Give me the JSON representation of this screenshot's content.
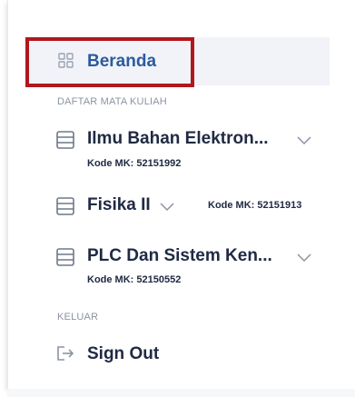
{
  "nav": {
    "home_label": "Beranda",
    "home_icon": "grid-icon"
  },
  "courses_section": {
    "heading": "DAFTAR MATA KULIAH",
    "courses": [
      {
        "title": "Ilmu Bahan Elektron...",
        "code": "Kode MK: 52151992",
        "icon": "course-list-icon",
        "expanded": false
      },
      {
        "title": "Fisika II",
        "code": "Kode MK: 52151913",
        "icon": "course-list-icon",
        "expanded": false
      },
      {
        "title": "PLC Dan Sistem Ken...",
        "code": "Kode MK: 52150552",
        "icon": "course-list-icon",
        "expanded": false
      }
    ]
  },
  "logout_section": {
    "heading": "KELUAR",
    "signout_label": "Sign Out",
    "signout_icon": "sign-out-icon"
  },
  "colors": {
    "accent": "#2c5aa0",
    "text": "#202a44",
    "muted": "#8b93a1",
    "active_bg": "#f1f3f8",
    "highlight": "#b0181d"
  }
}
